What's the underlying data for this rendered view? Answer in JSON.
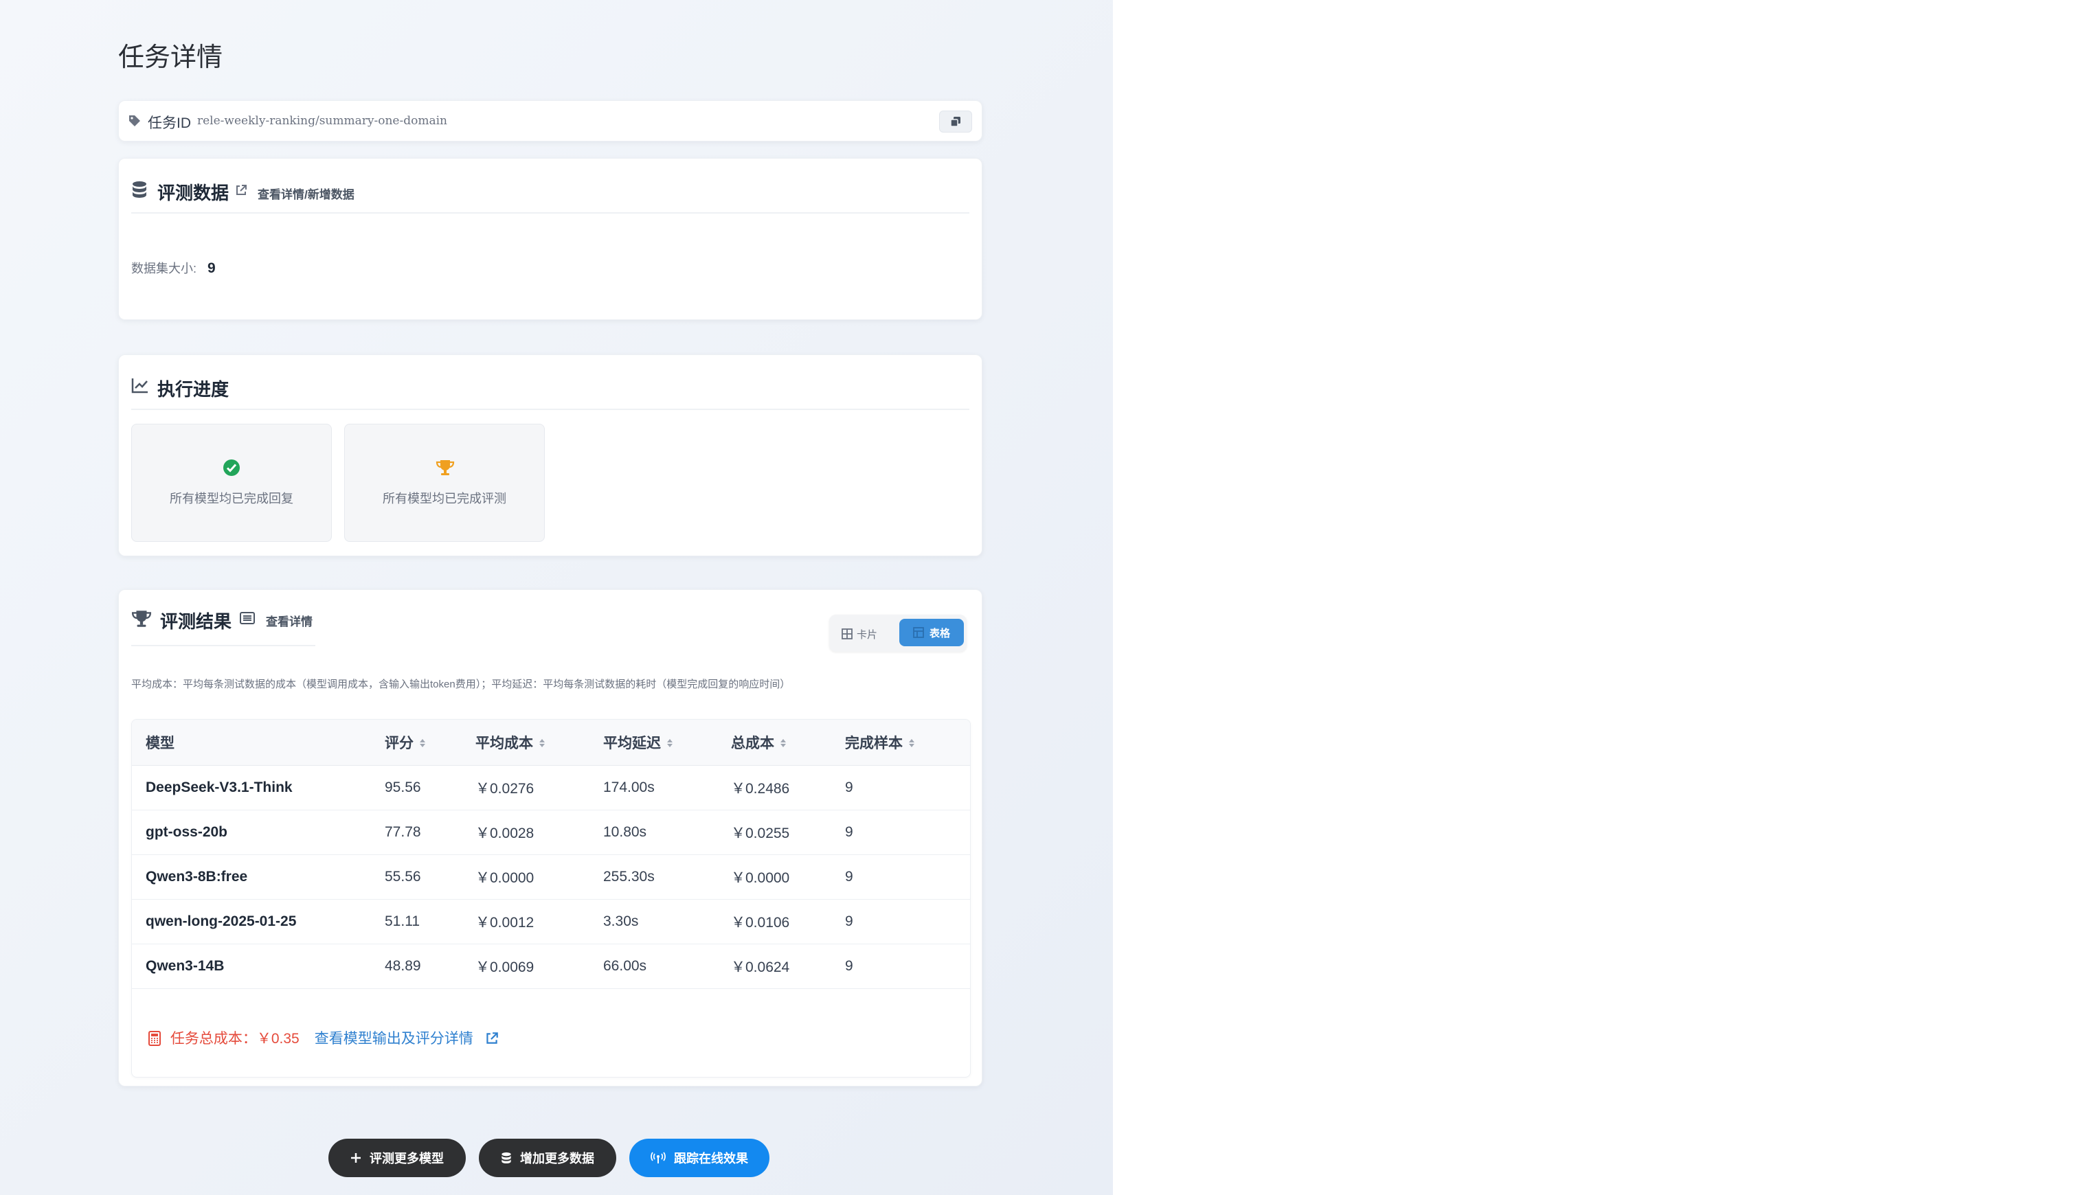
{
  "page": {
    "title": "任务详情"
  },
  "task": {
    "id_label": "任务ID",
    "id_value": "rele-weekly-ranking/summary-one-domain"
  },
  "dataset": {
    "title": "评测数据",
    "link": "查看详情/新增数据",
    "size_label": "数据集大小:",
    "size_value": "9"
  },
  "progress": {
    "title": "执行进度",
    "items": [
      {
        "text": "所有模型均已完成回复",
        "icon": "check-circle-icon",
        "color": "#22a55a"
      },
      {
        "text": "所有模型均已完成评测",
        "icon": "trophy-icon",
        "color": "#f0a020"
      }
    ]
  },
  "results": {
    "title": "评测结果",
    "link": "查看详情",
    "toggle": {
      "card": "卡片",
      "table": "表格",
      "active": "table"
    },
    "note": "平均成本：平均每条测试数据的成本（模型调用成本，含输入输出token费用）；平均延迟：平均每条测试数据的耗时（模型完成回复的响应时间）",
    "columns": [
      "模型",
      "评分",
      "平均成本",
      "平均延迟",
      "总成本",
      "完成样本"
    ],
    "rows": [
      [
        "DeepSeek-V3.1-Think",
        "95.56",
        "￥0.0276",
        "174.00s",
        "￥0.2486",
        "9"
      ],
      [
        "gpt-oss-20b",
        "77.78",
        "￥0.0028",
        "10.80s",
        "￥0.0255",
        "9"
      ],
      [
        "Qwen3-8B:free",
        "55.56",
        "￥0.0000",
        "255.30s",
        "￥0.0000",
        "9"
      ],
      [
        "qwen-long-2025-01-25",
        "51.11",
        "￥0.0012",
        "3.30s",
        "￥0.0106",
        "9"
      ],
      [
        "Qwen3-14B",
        "48.89",
        "￥0.0069",
        "66.00s",
        "￥0.0624",
        "9"
      ]
    ],
    "total_cost": "任务总成本：￥0.35",
    "detail_link": "查看模型输出及评分详情"
  },
  "actions": {
    "evaluate_more": "评测更多模型",
    "add_data": "增加更多数据",
    "track_online": "跟踪在线效果"
  },
  "colors": {
    "accent": "#1389f0",
    "danger": "#e54b3c",
    "link": "#2f80cf"
  }
}
